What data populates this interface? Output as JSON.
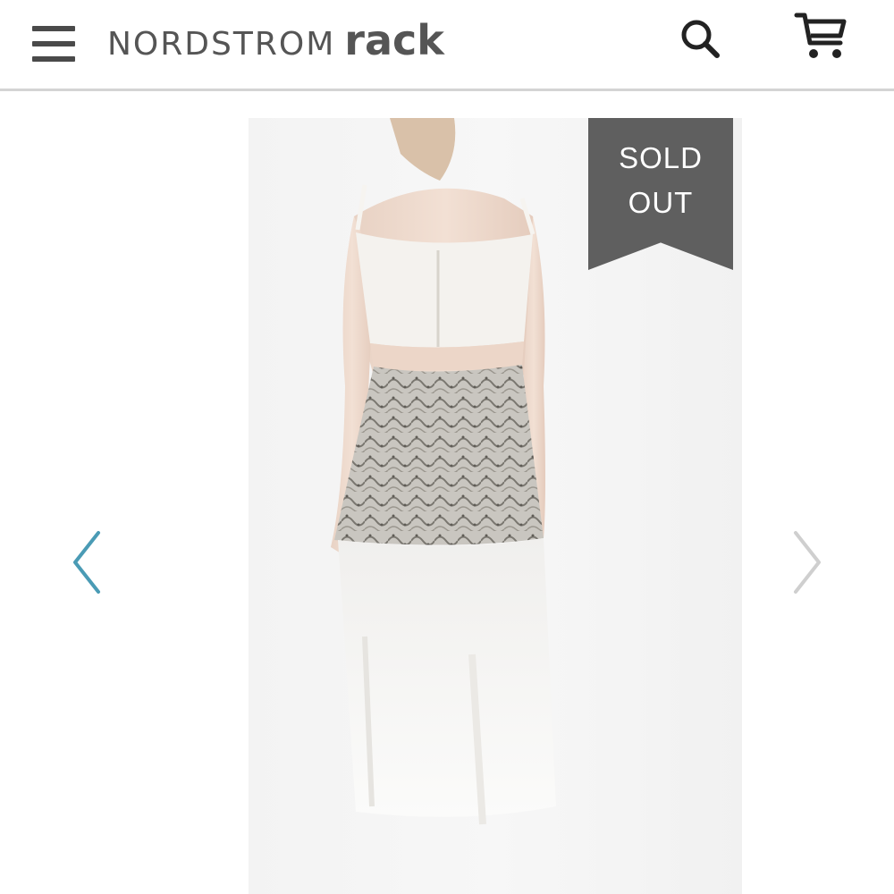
{
  "header": {
    "brand_name": "NORDSTROM",
    "brand_sub": "rack",
    "menu_icon": "hamburger-menu-icon",
    "search_icon": "search-icon",
    "cart_icon": "cart-icon"
  },
  "product": {
    "badge_line1": "SOLD",
    "badge_line2": "OUT",
    "image_alt": "Model wearing white crop top and patterned overlay skirt, back view"
  },
  "gallery": {
    "prev_icon": "chevron-left-icon",
    "next_icon": "chevron-right-icon"
  },
  "colors": {
    "header_text": "#555555",
    "badge_bg": "#5f5f5f",
    "prev_arrow": "#4a9bb5",
    "next_arrow": "#cfcfcf",
    "divider": "#d4d4d4"
  }
}
